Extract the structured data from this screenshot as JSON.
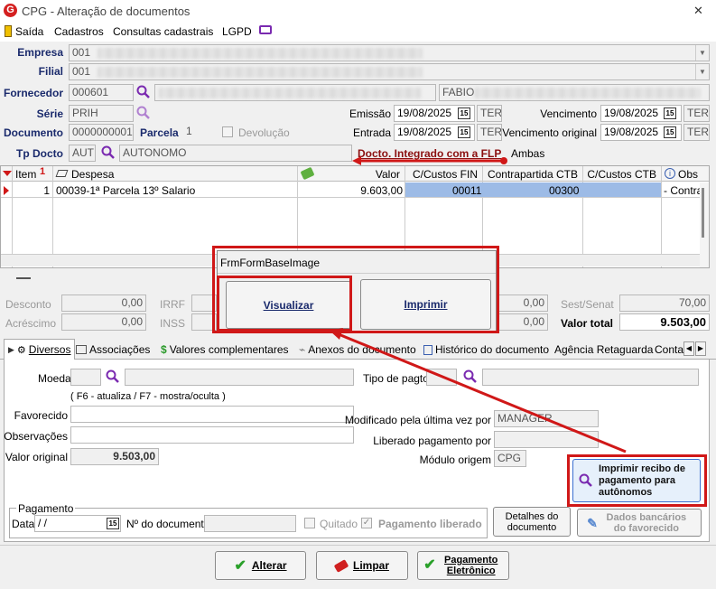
{
  "window": {
    "title": "CPG - Alteração de documentos",
    "close": "✕"
  },
  "menu": {
    "saida": "Saída",
    "cadastros": "Cadastros",
    "consultas": "Consultas cadastrais",
    "lgpd": "LGPD"
  },
  "form": {
    "empresa_label": "Empresa",
    "empresa_value": "001",
    "filial_label": "Filial",
    "filial_value": "001",
    "fornecedor_label": "Fornecedor",
    "fornecedor_value": "000601",
    "fornecedor_name_right": "FABIO",
    "serie_label": "Série",
    "serie_value": "PRIH",
    "documento_label": "Documento",
    "documento_value": "0000000001",
    "parcela_label": "Parcela",
    "parcela_value": "1",
    "devolucao_label": "Devolução",
    "tpdocto_label": "Tp Docto",
    "tpdocto_value": "AUT",
    "tpdocto_desc": "AUTONOMO",
    "integrado_label": "Docto. Integrado com a FLP",
    "integrado_value": "Ambas",
    "emissao_label": "Emissão",
    "emissao_value": "19/08/2025",
    "emissao_day": "TER",
    "entrada_label": "Entrada",
    "entrada_value": "19/08/2025",
    "entrada_day": "TER",
    "vencimento_label": "Vencimento",
    "vencimento_value": "19/08/2025",
    "vencimento_day": "TER",
    "vencorig_label": "Vencimento original",
    "vencorig_value": "19/08/2025",
    "vencorig_day": "TER",
    "cal_icon": "15"
  },
  "grid": {
    "headers": {
      "item": "Item",
      "despesa": "Despesa",
      "valor": "Valor",
      "ccustos_fin": "C/Custos FIN",
      "contrapartida": "Contrapartida CTB",
      "ccustos_ctb": "C/Custos CTB",
      "obs": "Obs"
    },
    "row": {
      "item": "1",
      "despesa": "00039-1ª Parcela 13º Salario",
      "valor": "9.603,00",
      "ccustos_fin": "00011",
      "contrapartida": "00300",
      "ccustos_ctb": "",
      "obs": "- Contra"
    }
  },
  "totals": {
    "desconto_label": "Desconto",
    "desconto_value": "0,00",
    "acrescimo_label": "Acréscimo",
    "acrescimo_value": "0,00",
    "irrf_label": "IRRF",
    "inss_label": "INSS",
    "mid1_value": "0,00",
    "mid2_value": "0,00",
    "sestsenat_label": "Sest/Senat",
    "sestsenat_value": "70,00",
    "valortotal_label": "Valor total",
    "valortotal_value": "9.503,00"
  },
  "popup": {
    "title": "FrmFormBaseImage",
    "visualizar": "Visualizar",
    "imprimir": "Imprimir"
  },
  "tabs": [
    "Diversos",
    "Associações",
    "Valores complementares",
    "Anexos do documento",
    "Histórico do documento",
    "Agência Retaguarda",
    "Contal"
  ],
  "diversos": {
    "moeda_label": "Moeda",
    "tipopagto_label": "Tipo de pagto",
    "hint": "( F6 - atualiza / F7 - mostra/oculta )",
    "favorecido_label": "Favorecido",
    "observacoes_label": "Observações",
    "valororiginal_label": "Valor original",
    "valororiginal_value": "9.503,00",
    "modificado_label": "Modificado pela última vez por",
    "modificado_value": "MANAGER",
    "liberado_label": "Liberado pagamento por",
    "modulo_label": "Módulo origem",
    "modulo_value": "CPG",
    "recibo_button": "Imprimir recibo de pagamento para autônomos"
  },
  "pagamento": {
    "group_label": "Pagamento",
    "data_label": "Data",
    "data_value": " /  /",
    "ndoc_label": "Nº do documento",
    "quitado_label": "Quitado",
    "liberado_label": "Pagamento liberado",
    "detalhes_button": "Detalhes do documento",
    "dados_bancarios_button": "Dados bancários do favorecido"
  },
  "footer": {
    "alterar": "Alterar",
    "limpar": "Limpar",
    "pagamento_eletronico": "Pagamento Eletrônico"
  },
  "colors": {
    "accent_red": "#d01818",
    "label_blue": "#1a2a6c",
    "selection": "#9dbbe6"
  }
}
